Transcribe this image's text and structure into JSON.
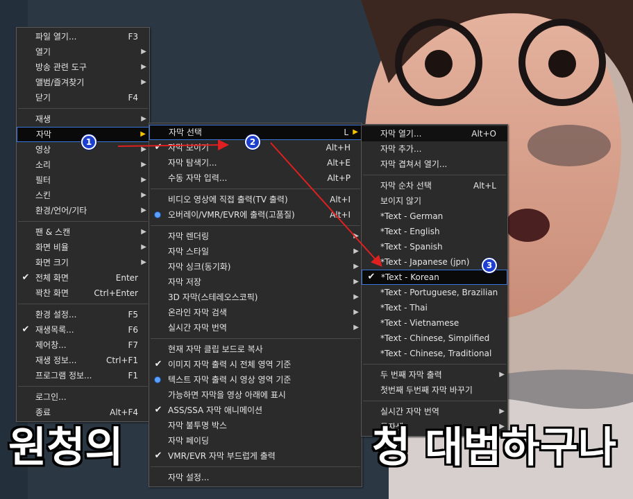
{
  "main_menu": {
    "groups": [
      [
        {
          "label": "파일 열기...",
          "shortcut": "F3"
        },
        {
          "label": "열기",
          "submenu": true
        },
        {
          "label": "방송 관련 도구",
          "submenu": true
        },
        {
          "label": "앨범/즐겨찾기",
          "submenu": true
        },
        {
          "label": "닫기",
          "shortcut": "F4"
        }
      ],
      [
        {
          "label": "재생",
          "submenu": true
        },
        {
          "label": "자막",
          "submenu": true,
          "highlight": true
        },
        {
          "label": "영상",
          "submenu": true
        },
        {
          "label": "소리",
          "submenu": true
        },
        {
          "label": "필터",
          "submenu": true
        },
        {
          "label": "스킨",
          "submenu": true
        },
        {
          "label": "환경/언어/기타",
          "submenu": true
        }
      ],
      [
        {
          "label": "팬 & 스캔",
          "submenu": true
        },
        {
          "label": "화면 비율",
          "submenu": true
        },
        {
          "label": "화면 크기",
          "submenu": true
        },
        {
          "label": "전체 화면",
          "shortcut": "Enter",
          "check": true
        },
        {
          "label": "꽉찬 화면",
          "shortcut": "Ctrl+Enter"
        }
      ],
      [
        {
          "label": "환경 설정...",
          "shortcut": "F5"
        },
        {
          "label": "재생목록...",
          "shortcut": "F6",
          "check": true
        },
        {
          "label": "제어창...",
          "shortcut": "F7"
        },
        {
          "label": "재생 정보...",
          "shortcut": "Ctrl+F1"
        },
        {
          "label": "프로그램 정보...",
          "shortcut": "F1"
        }
      ],
      [
        {
          "label": "로그인..."
        },
        {
          "label": "종료",
          "shortcut": "Alt+F4"
        }
      ]
    ]
  },
  "subtitle_menu": {
    "groups": [
      [
        {
          "label": "자막 선택",
          "shortcut": "L",
          "submenu": true,
          "highlight": true
        },
        {
          "label": "자막 보이기",
          "shortcut": "Alt+H",
          "check": true
        },
        {
          "label": "자막 탐색기...",
          "shortcut": "Alt+E"
        },
        {
          "label": "수동 자막 입력...",
          "shortcut": "Alt+P"
        }
      ],
      [
        {
          "label": "비디오 영상에 직접 출력(TV 출력)",
          "shortcut": "Alt+I"
        },
        {
          "label": "오버레이/VMR/EVR에 출력(고품질)",
          "shortcut": "Alt+I",
          "radio": true
        }
      ],
      [
        {
          "label": "자막 렌더링",
          "submenu": true
        },
        {
          "label": "자막 스타일",
          "submenu": true
        },
        {
          "label": "자막 싱크(동기화)",
          "submenu": true
        },
        {
          "label": "자막 저장",
          "submenu": true
        },
        {
          "label": "3D 자막(스테레오스코픽)",
          "submenu": true
        },
        {
          "label": "온라인 자막 검색",
          "submenu": true
        },
        {
          "label": "실시간 자막 번역",
          "submenu": true
        }
      ],
      [
        {
          "label": "현재 자막 클립 보드로 복사"
        },
        {
          "label": "이미지 자막 출력 시 전체 영역 기준",
          "check": true
        },
        {
          "label": "텍스트 자막 출력 시 영상 영역 기준",
          "radio": true
        },
        {
          "label": "가능하면 자막을 영상 아래에 표시"
        },
        {
          "label": "ASS/SSA 자막 애니메이션",
          "check": true
        },
        {
          "label": "자막 불투명 박스"
        },
        {
          "label": "자막 페이딩"
        },
        {
          "label": "VMR/EVR 자막 부드럽게 출력",
          "check": true
        }
      ],
      [
        {
          "label": "자막 설정..."
        }
      ]
    ]
  },
  "select_menu": {
    "groups": [
      [
        {
          "label": "자막 열기...",
          "shortcut": "Alt+O",
          "dark": true
        },
        {
          "label": "자막 추가..."
        },
        {
          "label": "자막 겹쳐서 열기..."
        }
      ],
      [
        {
          "label": "자막 순차 선택",
          "shortcut": "Alt+L"
        },
        {
          "label": "보이지 않기"
        },
        {
          "label": "*Text - German"
        },
        {
          "label": "*Text - English"
        },
        {
          "label": "*Text - Spanish"
        },
        {
          "label": "*Text - Japanese (jpn)"
        },
        {
          "label": "*Text - Korean",
          "check": true,
          "highlight": true
        },
        {
          "label": "*Text - Portuguese, Brazilian"
        },
        {
          "label": "*Text - Thai"
        },
        {
          "label": "*Text - Vietnamese"
        },
        {
          "label": "*Text - Chinese, Simplified"
        },
        {
          "label": "*Text - Chinese, Traditional"
        }
      ],
      [
        {
          "label": "두 번째 자막 출력",
          "submenu": true
        },
        {
          "label": "첫번째 두번째 자막 바꾸기"
        }
      ],
      [
        {
          "label": "실시간 자막 번역",
          "submenu": true
        },
        {
          "label": "문자셋",
          "submenu": true
        }
      ]
    ]
  },
  "badges": [
    "1",
    "2",
    "3"
  ],
  "caption": {
    "left": "원청의",
    "right": "청 대범하구나"
  },
  "colors": {
    "highlight_border": "#3a78e0",
    "arrow": "#e02020",
    "badge": "#1d3fd0",
    "submenu_arrow_active": "#f4c400"
  },
  "icons": {
    "check": "check-icon",
    "radio": "radio-dot-icon",
    "submenu": "submenu-arrow-icon"
  }
}
